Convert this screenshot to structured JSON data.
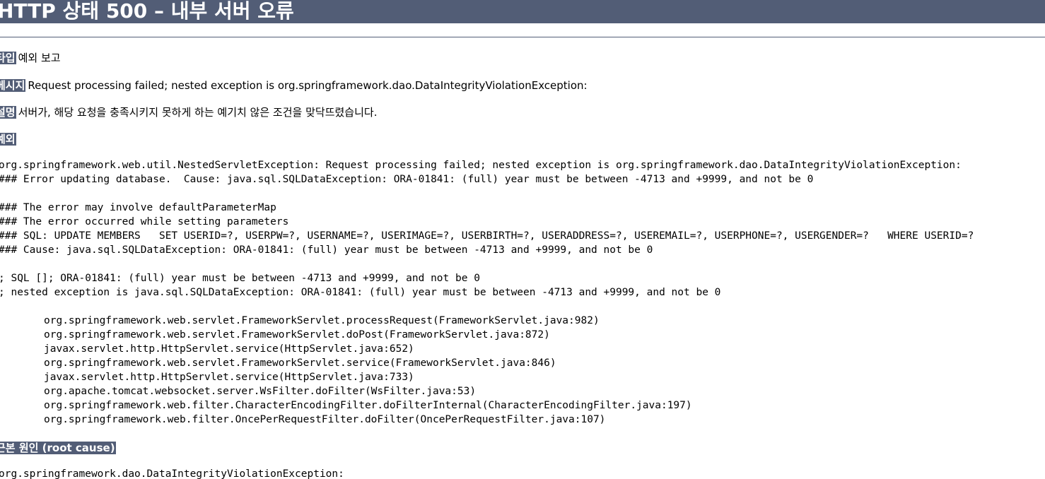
{
  "header": {
    "title": "HTTP 상태 500 – 내부 서버 오류"
  },
  "report": {
    "type_label": "타입",
    "type_value": "예외 보고",
    "message_label": "메시지",
    "message_value": "Request processing failed; nested exception is org.springframework.dao.DataIntegrityViolationException:",
    "description_label": "설명",
    "description_value": "서버가, 해당 요청을 충족시키지 못하게 하는 예기치 않은 조건을 맞닥뜨렸습니다.",
    "exception_label": "예외"
  },
  "exception_trace": {
    "line1": "org.springframework.web.util.NestedServletException: Request processing failed; nested exception is org.springframework.dao.DataIntegrityViolationException:",
    "line2": "### Error updating database.  Cause: java.sql.SQLDataException: ORA-01841: (full) year must be between -4713 and +9999, and not be 0",
    "line3": "### The error may involve defaultParameterMap",
    "line4": "### The error occurred while setting parameters",
    "line5": "### SQL: UPDATE MEMBERS   SET USERID=?, USERPW=?, USERNAME=?, USERIMAGE=?, USERBIRTH=?, USERADDRESS=?, USEREMAIL=?, USERPHONE=?, USERGENDER=?   WHERE USERID=?",
    "line6": "### Cause: java.sql.SQLDataException: ORA-01841: (full) year must be between -4713 and +9999, and not be 0",
    "line7": "; SQL []; ORA-01841: (full) year must be between -4713 and +9999, and not be 0",
    "line8": "; nested exception is java.sql.SQLDataException: ORA-01841: (full) year must be between -4713 and +9999, and not be 0",
    "frames": [
      "org.springframework.web.servlet.FrameworkServlet.processRequest(FrameworkServlet.java:982)",
      "org.springframework.web.servlet.FrameworkServlet.doPost(FrameworkServlet.java:872)",
      "javax.servlet.http.HttpServlet.service(HttpServlet.java:652)",
      "org.springframework.web.servlet.FrameworkServlet.service(FrameworkServlet.java:846)",
      "javax.servlet.http.HttpServlet.service(HttpServlet.java:733)",
      "org.apache.tomcat.websocket.server.WsFilter.doFilter(WsFilter.java:53)",
      "org.springframework.web.filter.CharacterEncodingFilter.doFilterInternal(CharacterEncodingFilter.java:197)",
      "org.springframework.web.filter.OncePerRequestFilter.doFilter(OncePerRequestFilter.java:107)"
    ]
  },
  "root_cause": {
    "label": "근본 원인 (root cause)",
    "line1": "org.springframework.dao.DataIntegrityViolationException:"
  }
}
